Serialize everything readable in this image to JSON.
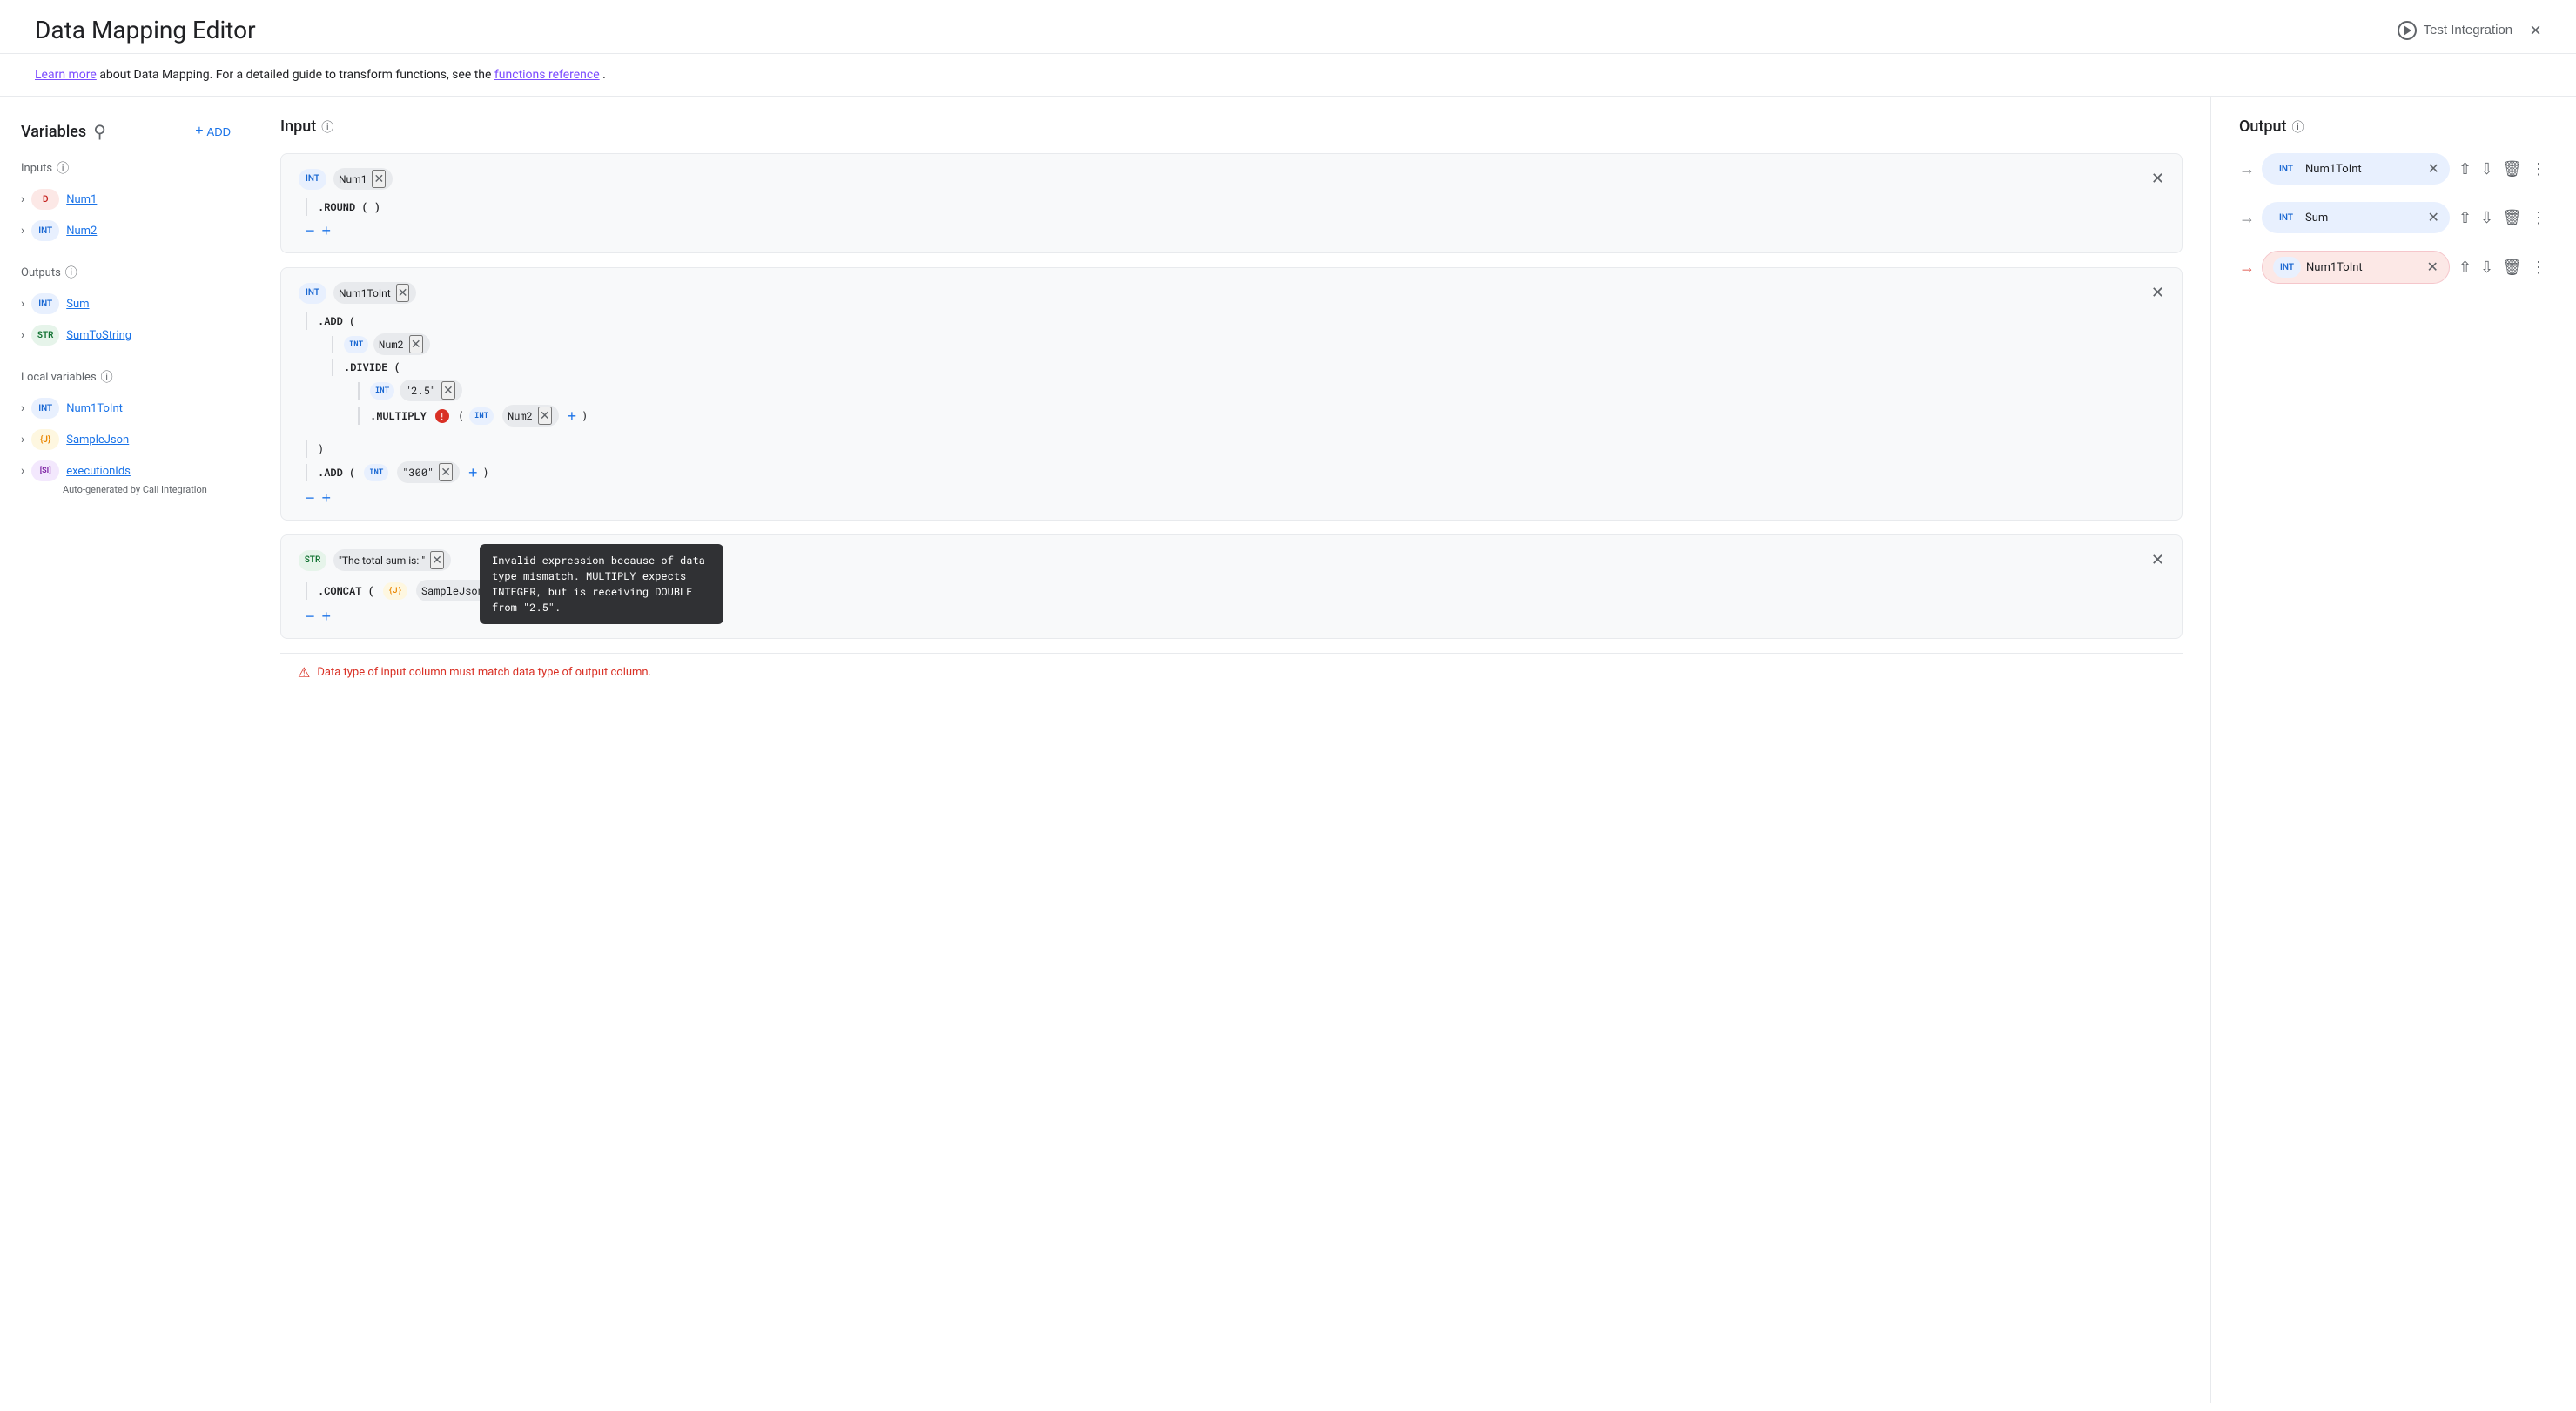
{
  "header": {
    "title": "Data Mapping Editor",
    "test_integration_label": "Test Integration",
    "close_label": "×"
  },
  "info_bar": {
    "text_before": "Learn more about Data Mapping. For a detailed guide to transform functions, see the ",
    "learn_more_label": "Learn more",
    "link_label": "functions reference",
    "text_after": "."
  },
  "sidebar": {
    "title": "Variables",
    "add_label": "ADD",
    "inputs_label": "Inputs",
    "outputs_label": "Outputs",
    "local_variables_label": "Local variables",
    "inputs": [
      {
        "name": "Num1",
        "type": "D",
        "type_key": "d"
      },
      {
        "name": "Num2",
        "type": "INT",
        "type_key": "int"
      }
    ],
    "outputs": [
      {
        "name": "Sum",
        "type": "INT",
        "type_key": "int"
      },
      {
        "name": "SumToString",
        "type": "STR",
        "type_key": "str"
      }
    ],
    "local_variables": [
      {
        "name": "Num1ToInt",
        "type": "INT",
        "type_key": "int",
        "sub": ""
      },
      {
        "name": "SampleJson",
        "type": "J",
        "type_key": "j",
        "sub": ""
      },
      {
        "name": "executionIds",
        "type": "SI",
        "type_key": "si",
        "sub": "Auto-generated by Call Integration"
      }
    ]
  },
  "input_panel": {
    "title": "Input",
    "cards": [
      {
        "id": "card1",
        "header_type": "INT",
        "header_name": "Num1",
        "function_line": ".ROUND ( )"
      },
      {
        "id": "card2",
        "header_type": "INT",
        "header_name": "Num1ToInt",
        "lines": [
          {
            "text": ".ADD (",
            "indent": 0
          },
          {
            "type": "INT",
            "name": "Num2",
            "indent": 1
          },
          {
            "text": ".DIVIDE (",
            "indent": 1
          },
          {
            "type": "INT",
            "name": "\"2.5\"",
            "indent": 2
          },
          {
            "text": ".MULTIPLY",
            "error": true,
            "suffix": "( INT Num2 ×  + )",
            "indent": 2
          }
        ],
        "tooltip": "Invalid expression because of data type mismatch. MULTIPLY expects INTEGER, but is receiving DOUBLE from \"2.5\".",
        "bottom_lines": [
          {
            "text": ")"
          },
          {
            "text": ".ADD ( INT \"300\" × + )"
          }
        ]
      },
      {
        "id": "card3",
        "header_type": "STR",
        "header_name": "\"The total sum is: \"",
        "lines": [
          {
            "text": ".CONCAT (",
            "indent": 0
          },
          {
            "type": "J",
            "name": "SampleJson",
            "indent": 1
          }
        ]
      }
    ]
  },
  "output_panel": {
    "title": "Output",
    "rows": [
      {
        "arrow": "→",
        "arrow_color": "gray",
        "type": "INT",
        "name": "Num1ToInt"
      },
      {
        "arrow": "→",
        "arrow_color": "gray",
        "type": "INT",
        "name": "Sum"
      },
      {
        "arrow": "→",
        "arrow_color": "red",
        "type": "INT",
        "name": "Num1ToInt"
      }
    ]
  },
  "error_bar": {
    "message": "Data type of input column must match data type of output column."
  }
}
